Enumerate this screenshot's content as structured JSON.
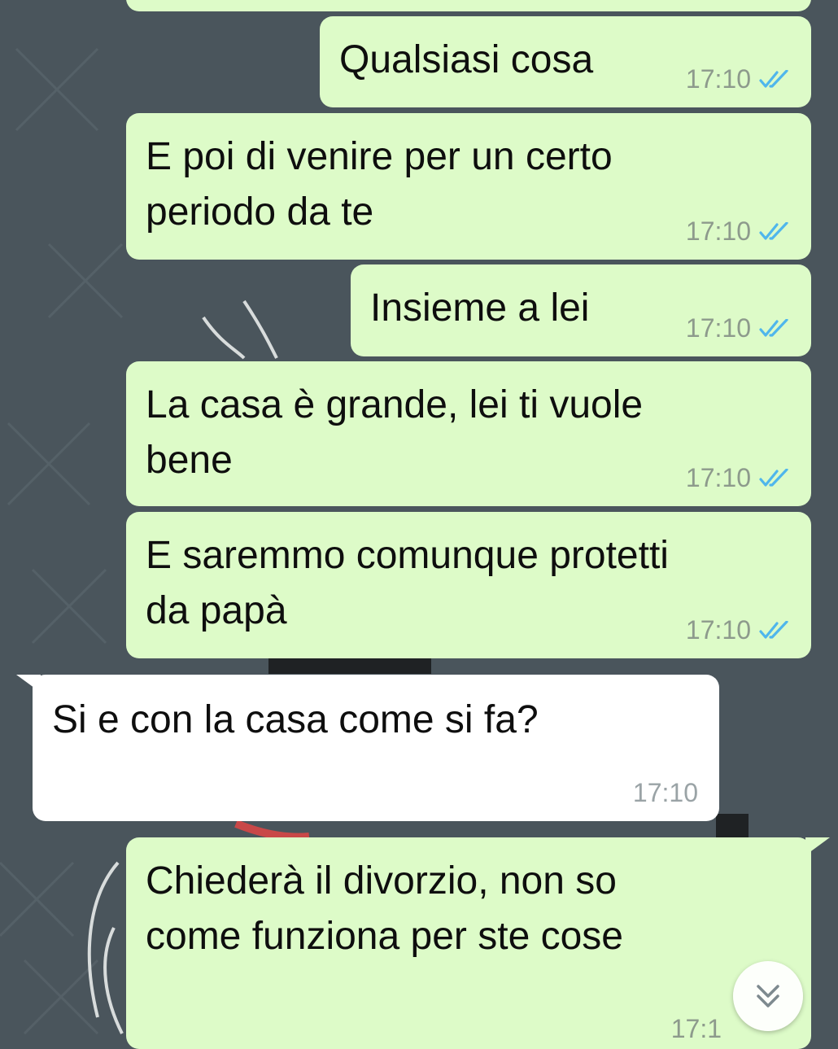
{
  "messages": [
    {
      "text": "Qualsiasi cosa",
      "time": "17:10",
      "direction": "outgoing",
      "status": "read"
    },
    {
      "text": "E poi di venire per un certo\nperiodo da te",
      "time": "17:10",
      "direction": "outgoing",
      "status": "read"
    },
    {
      "text": "Insieme a lei",
      "time": "17:10",
      "direction": "outgoing",
      "status": "read"
    },
    {
      "text": "La casa è grande, lei ti vuole\nbene",
      "time": "17:10",
      "direction": "outgoing",
      "status": "read"
    },
    {
      "text": "E saremmo comunque protetti\nda papà",
      "time": "17:10",
      "direction": "outgoing",
      "status": "read"
    },
    {
      "text": "Si e con la casa come si fa?",
      "time": "17:10",
      "direction": "incoming"
    },
    {
      "text": "Chiederà il divorzio, non so\ncome funziona per ste cose",
      "time": "17:1",
      "direction": "outgoing",
      "status": "read"
    }
  ],
  "colors": {
    "outgoing_bubble": "#ddfbc8",
    "incoming_bubble": "#ffffff",
    "read_ticks": "#4fb6ec",
    "background": "#4a555c"
  },
  "icons": {
    "read_receipt": "double-check-icon",
    "scroll_down": "chevron-double-down-icon"
  }
}
